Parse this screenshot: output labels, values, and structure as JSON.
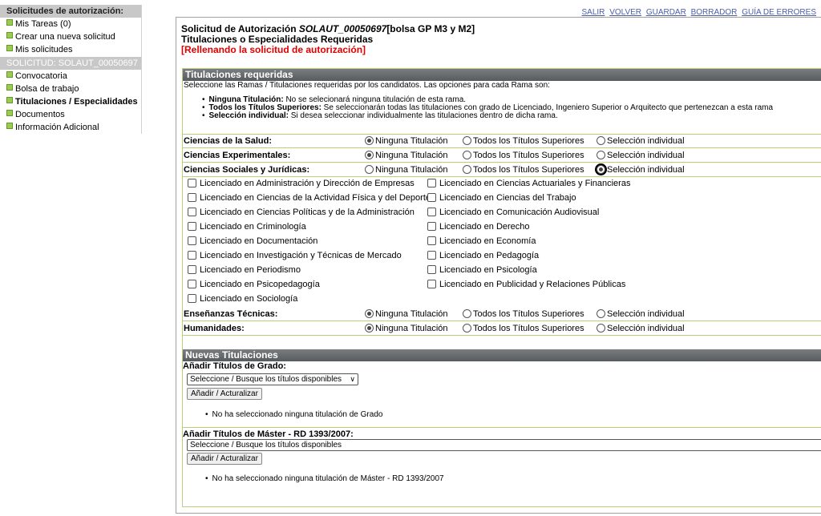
{
  "sidebar": {
    "header": "Solicitudes de autorización:",
    "items_top": [
      {
        "label": "Mis Tareas (0)"
      },
      {
        "label": "Crear una nueva solicitud"
      },
      {
        "label": "Mis solicitudes"
      }
    ],
    "subheader": "SOLICITUD: SOLAUT_00050697",
    "items_bottom": [
      {
        "label": "Convocatoria"
      },
      {
        "label": "Bolsa de trabajo"
      },
      {
        "label": "Titulaciones / Especialidades"
      },
      {
        "label": "Documentos"
      },
      {
        "label": "Información Adicional"
      }
    ]
  },
  "top_links": [
    "SALIR",
    "VOLVER",
    "GUARDAR",
    "BORRADOR",
    "GUÍA DE ERRORES"
  ],
  "heading": {
    "prefix": "Solicitud de Autorización ",
    "code": "SOLAUT_00050697",
    "suffix": "[bolsa GP M3 y M2]",
    "line2": "Titulaciones o Especialidades Requeridas",
    "line3": "[Rellenando la solicitud de autorización]"
  },
  "section1": {
    "title": "Titulaciones requeridas",
    "intro": "Seleccione las Ramas / Titulaciones requeridas por los candidatos. Las opciones para cada Rama son:",
    "bullets": [
      {
        "bold": "Ninguna Titulación:",
        "text": " No se selecionará ninguna titulación de esta rama."
      },
      {
        "bold": "Todos los Títulos Superiores:",
        "text": " Se seleccionarán todas las titulaciones con grado de Licenciado, Ingeniero Superior o Arquitecto que pertenezcan a esta rama"
      },
      {
        "bold": "Selección individual:",
        "text": " Si desea seleccionar individualmente las titulaciones dentro de dicha rama."
      }
    ],
    "options": [
      "Ninguna Titulación",
      "Todos los Títulos Superiores",
      "Selección individual"
    ],
    "ramas": [
      {
        "name": "Ciencias de la Salud:",
        "selected": 0
      },
      {
        "name": "Ciencias Experimentales:",
        "selected": 0
      },
      {
        "name": "Ciencias Sociales y Jurídicas:",
        "selected": 2
      },
      {
        "name": "Enseñanzas Técnicas:",
        "selected": 0
      },
      {
        "name": "Humanidades:",
        "selected": 0
      }
    ],
    "titulaciones": [
      "Licenciado en Administración y Dirección de Empresas",
      "Licenciado en Ciencias Actuariales y Financieras",
      "Licenciado en Ciencias de la Actividad Física y del Deporte",
      "Licenciado en Ciencias del Trabajo",
      "Licenciado en Ciencias Políticas y de la Administración",
      "Licenciado en Comunicación Audiovisual",
      "Licenciado en Criminología",
      "Licenciado en Derecho",
      "Licenciado en Documentación",
      "Licenciado en Economía",
      "Licenciado en Investigación y Técnicas de Mercado",
      "Licenciado en Pedagogía",
      "Licenciado en Periodismo",
      "Licenciado en Psicología",
      "Licenciado en Psicopedagogía",
      "Licenciado en Publicidad y Relaciones Públicas",
      "Licenciado en Sociología"
    ]
  },
  "section2": {
    "title": "Nuevas Titulaciones",
    "grado": {
      "label": "Añadir Títulos de Grado:",
      "select": "Seleccione / Busque los títulos disponibles",
      "button": "Añadir / Acturalizar",
      "empty": "No ha seleccionado ninguna titulación de Grado"
    },
    "master": {
      "label": "Añadir Títulos de Máster - RD 1393/2007:",
      "select": "Seleccione / Busque los títulos disponibles",
      "button": "Añadir / Acturalizar",
      "empty": "No ha seleccionado ninguna titulación de Máster - RD 1393/2007"
    }
  }
}
